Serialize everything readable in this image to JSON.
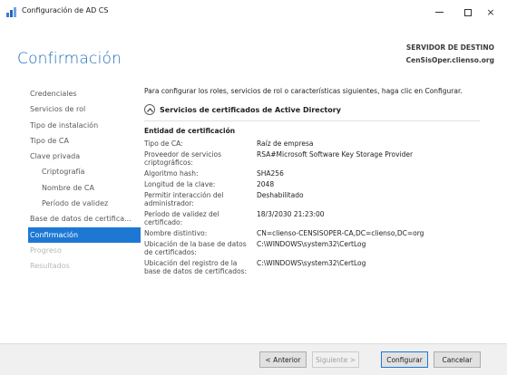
{
  "window": {
    "title": "Configuración de AD CS",
    "icon": "chart-bars-icon",
    "controls": {
      "minimize": "minimize-icon",
      "maximize": "maximize-icon",
      "close": "×"
    }
  },
  "header": {
    "title": "Confirmación",
    "destination_label": "SERVIDOR DE DESTINO",
    "destination_server": "CenSisOper.clienso.org",
    "title_color": "#1a6ab5"
  },
  "sidebar": {
    "items": [
      {
        "label": "Credenciales",
        "state": "normal"
      },
      {
        "label": "Servicios de rol",
        "state": "normal"
      },
      {
        "label": "Tipo de instalación",
        "state": "normal"
      },
      {
        "label": "Tipo de CA",
        "state": "normal"
      },
      {
        "label": "Clave privada",
        "state": "normal"
      },
      {
        "label": "Criptografía",
        "state": "normal",
        "sub": true
      },
      {
        "label": "Nombre de CA",
        "state": "normal",
        "sub": true
      },
      {
        "label": "Período de validez",
        "state": "normal",
        "sub": true
      },
      {
        "label": "Base de datos de certifica...",
        "state": "normal"
      },
      {
        "label": "Confirmación",
        "state": "active"
      },
      {
        "label": "Progreso",
        "state": "disabled"
      },
      {
        "label": "Resultados",
        "state": "disabled"
      }
    ],
    "active_color": "#1d78d4"
  },
  "main": {
    "intro": "Para configurar los roles, servicios de rol o características siguientes, haga clic en Configurar.",
    "section_title": "Servicios de certificados de Active Directory",
    "entity_title": "Entidad de certificación",
    "properties": [
      {
        "label": "Tipo de CA:",
        "value": "Raíz de empresa"
      },
      {
        "label": "Proveedor de servicios criptográficos:",
        "value": "RSA#Microsoft Software Key Storage Provider"
      },
      {
        "label": "Algoritmo hash:",
        "value": "SHA256"
      },
      {
        "label": "Longitud de la clave:",
        "value": "2048"
      },
      {
        "label": "Permitir interacción del administrador:",
        "value": "Deshabilitado"
      },
      {
        "label": "Período de validez del certificado:",
        "value": "18/3/2030 21:23:00"
      },
      {
        "label": "Nombre distintivo:",
        "value": "CN=clienso-CENSISOPER-CA,DC=clienso,DC=org"
      },
      {
        "label": "Ubicación de la base de datos de certificados:",
        "value": "C:\\WINDOWS\\system32\\CertLog"
      },
      {
        "label": "Ubicación del registro de la base de datos de certificados:",
        "value": "C:\\WINDOWS\\system32\\CertLog"
      }
    ]
  },
  "footer": {
    "prev_label": "< Anterior",
    "next_label": "Siguiente >",
    "configure_label": "Configurar",
    "cancel_label": "Cancelar"
  }
}
